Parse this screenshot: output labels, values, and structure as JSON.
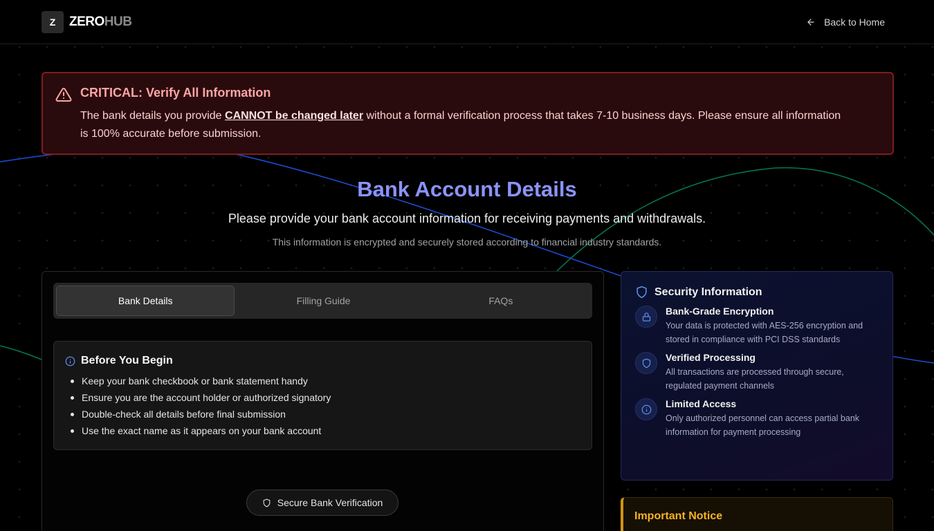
{
  "header": {
    "logo_mark": "Z",
    "logo_text_a": "ZERO",
    "logo_text_b": "HUB",
    "back_label": "Back to Home"
  },
  "alert": {
    "title": "CRITICAL: Verify All Information",
    "body_prefix": "The bank details you provide ",
    "body_emphasis": "CANNOT be changed later",
    "body_suffix": " without a formal verification process that takes 7-10 business days. Please ensure all information is 100% accurate before submission."
  },
  "page": {
    "title": "Bank Account Details",
    "subtitle": "Please provide your bank account information for receiving payments and withdrawals.",
    "note": "This information is encrypted and securely stored according to financial industry standards."
  },
  "tabs": [
    {
      "label": "Bank Details",
      "active": true
    },
    {
      "label": "Filling Guide",
      "active": false
    },
    {
      "label": "FAQs",
      "active": false
    }
  ],
  "before_begin": {
    "title": "Before You Begin",
    "items": [
      "Keep your bank checkbook or bank statement handy",
      "Ensure you are the account holder or authorized signatory",
      "Double-check all details before final submission",
      "Use the exact name as it appears on your bank account"
    ]
  },
  "verify_pill": {
    "label": "Secure Bank Verification",
    "icon": "shield-icon"
  },
  "security": {
    "title": "Security Information",
    "items": [
      {
        "icon": "lock-icon",
        "title": "Bank-Grade Encryption",
        "desc": "Your data is protected with AES-256 encryption and stored in compliance with PCI DSS standards"
      },
      {
        "icon": "shield-icon",
        "title": "Verified Processing",
        "desc": "All transactions are processed through secure, regulated payment channels"
      },
      {
        "icon": "info-icon",
        "title": "Limited Access",
        "desc": "Only authorized personnel can access partial bank information for payment processing"
      }
    ]
  },
  "notice": {
    "title": "Important Notice"
  },
  "colors": {
    "accent_title": "#8b93f8",
    "alert_border": "#7f1d1d",
    "alert_title": "#fca5a5",
    "security_icon": "#5b8def",
    "notice_accent": "#d19410",
    "curve_blue": "#1d4ed8",
    "curve_green": "#047857"
  }
}
